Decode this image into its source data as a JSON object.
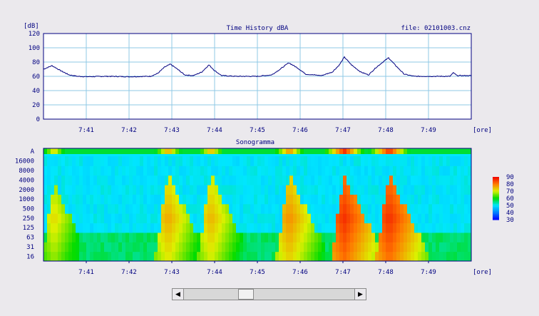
{
  "chart_data": [
    {
      "type": "line",
      "title": "Time History dBA",
      "file_label": "file: 02101003.cnz",
      "ylabel": "[dB]",
      "xlabel": "[ore]",
      "ylim": [
        0,
        120
      ],
      "yticks": [
        0,
        20,
        40,
        60,
        80,
        100,
        120
      ],
      "x_range": [
        "7:40",
        "7:50"
      ],
      "xticks": [
        "7:41",
        "7:42",
        "7:43",
        "7:44",
        "7:45",
        "7:46",
        "7:47",
        "7:48",
        "7:49"
      ],
      "grid": true,
      "series": [
        {
          "color": "#000080",
          "points": [
            [
              "7:40:00",
              70
            ],
            [
              "7:40:12",
              75
            ],
            [
              "7:40:24",
              68
            ],
            [
              "7:40:36",
              62
            ],
            [
              "7:40:48",
              60
            ],
            [
              "7:41:00",
              59.5
            ],
            [
              "7:41:30",
              60
            ],
            [
              "7:42:00",
              59.5
            ],
            [
              "7:42:30",
              60
            ],
            [
              "7:42:40",
              64
            ],
            [
              "7:42:50",
              73
            ],
            [
              "7:42:58",
              77
            ],
            [
              "7:43:08",
              70
            ],
            [
              "7:43:18",
              62
            ],
            [
              "7:43:30",
              61
            ],
            [
              "7:43:42",
              66
            ],
            [
              "7:43:52",
              76
            ],
            [
              "7:44:00",
              68
            ],
            [
              "7:44:10",
              61
            ],
            [
              "7:44:30",
              60
            ],
            [
              "7:45:00",
              60
            ],
            [
              "7:45:20",
              62
            ],
            [
              "7:45:32",
              70
            ],
            [
              "7:45:44",
              79
            ],
            [
              "7:45:56",
              72
            ],
            [
              "7:46:08",
              63
            ],
            [
              "7:46:30",
              61
            ],
            [
              "7:46:45",
              66
            ],
            [
              "7:46:55",
              76
            ],
            [
              "7:47:02",
              87
            ],
            [
              "7:47:12",
              76
            ],
            [
              "7:47:25",
              66
            ],
            [
              "7:47:36",
              62
            ],
            [
              "7:47:46",
              72
            ],
            [
              "7:47:56",
              80
            ],
            [
              "7:48:04",
              86
            ],
            [
              "7:48:14",
              75
            ],
            [
              "7:48:26",
              63
            ],
            [
              "7:48:40",
              60
            ],
            [
              "7:49:00",
              60
            ],
            [
              "7:49:30",
              60
            ],
            [
              "7:49:35",
              65
            ],
            [
              "7:49:40",
              61
            ],
            [
              "7:50:00",
              61
            ]
          ]
        }
      ]
    },
    {
      "type": "heatmap",
      "title": "Sonogramma",
      "xlabel": "[ore]",
      "y_categories": [
        "16",
        "31",
        "63",
        "125",
        "250",
        "500",
        "1000",
        "2000",
        "4000",
        "8000",
        "16000",
        "A"
      ],
      "x_range": [
        "7:40",
        "7:50"
      ],
      "xticks": [
        "7:41",
        "7:42",
        "7:43",
        "7:44",
        "7:45",
        "7:46",
        "7:47",
        "7:48",
        "7:49"
      ],
      "colorbar": {
        "ticks": [
          90,
          80,
          70,
          60,
          50,
          40,
          30
        ],
        "range": [
          30,
          90
        ]
      },
      "background_level_db": 50,
      "events": [
        {
          "time": "7:40:15",
          "peak_db": 72,
          "max_band": "2000"
        },
        {
          "time": "7:42:55",
          "peak_db": 76,
          "max_band": "4000"
        },
        {
          "time": "7:43:55",
          "peak_db": 75,
          "max_band": "4000"
        },
        {
          "time": "7:45:45",
          "peak_db": 78,
          "max_band": "4000"
        },
        {
          "time": "7:47:02",
          "peak_db": 86,
          "max_band": "4000"
        },
        {
          "time": "7:48:05",
          "peak_db": 86,
          "max_band": "4000"
        }
      ]
    }
  ],
  "scrollbar": {
    "left_arrow": "◀",
    "right_arrow": "▶",
    "thumb_position": 0.32,
    "thumb_fraction": 0.09
  }
}
